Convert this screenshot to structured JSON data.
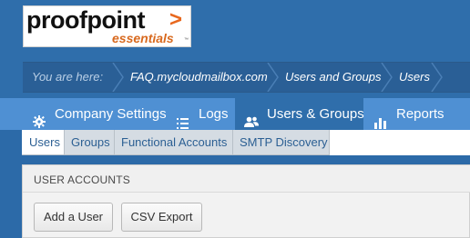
{
  "logo": {
    "brand": "proofpoint",
    "caret": ">",
    "product": "essentials",
    "tm": "™"
  },
  "breadcrumb": {
    "prefix": "You are here:",
    "items": [
      "FAQ.mycloudmailbox.com",
      "Users and Groups",
      "Users"
    ]
  },
  "nav": {
    "items": [
      {
        "label": "Company Settings",
        "icon": "gear-icon"
      },
      {
        "label": "Logs",
        "icon": "list-icon"
      },
      {
        "label": "Users & Groups",
        "icon": "users-icon",
        "active": true
      },
      {
        "label": "Reports",
        "icon": "chart-icon"
      }
    ]
  },
  "subnav": {
    "items": [
      {
        "label": "Users",
        "active": true
      },
      {
        "label": "Groups"
      },
      {
        "label": "Functional Accounts"
      },
      {
        "label": "SMTP Discovery"
      }
    ]
  },
  "panel": {
    "title": "USER ACCOUNTS",
    "buttons": {
      "add_user": "Add a User",
      "csv_export": "CSV Export"
    }
  },
  "colors": {
    "header_bg": "#2f6eab",
    "nav_bg": "#4f90d3",
    "nav_active": "#2f6eab",
    "subnav_bg": "#d5dce3",
    "accent_orange": "#e8681e"
  }
}
